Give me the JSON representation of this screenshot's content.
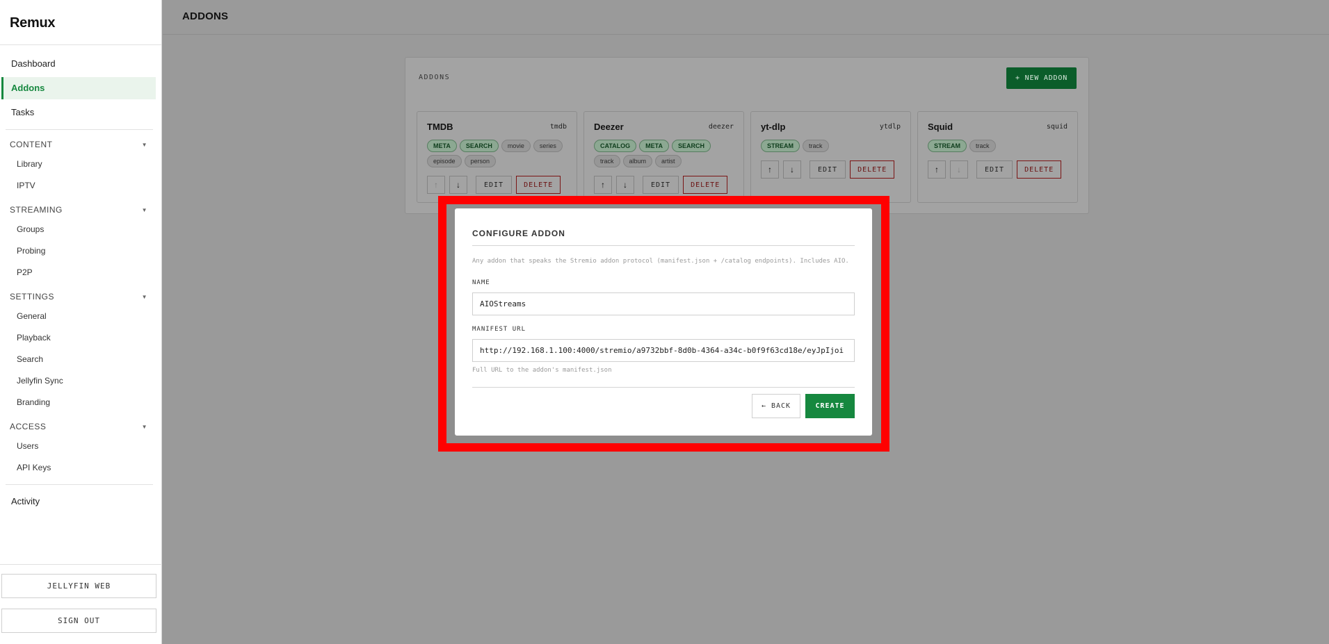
{
  "app": {
    "name": "Remux"
  },
  "sidebar": {
    "top_items": [
      {
        "label": "Dashboard"
      },
      {
        "label": "Addons"
      },
      {
        "label": "Tasks"
      }
    ],
    "sections": [
      {
        "title": "CONTENT",
        "items": [
          "Library",
          "IPTV"
        ]
      },
      {
        "title": "STREAMING",
        "items": [
          "Groups",
          "Probing",
          "P2P"
        ]
      },
      {
        "title": "SETTINGS",
        "items": [
          "General",
          "Playback",
          "Search",
          "Jellyfin Sync",
          "Branding"
        ]
      },
      {
        "title": "ACCESS",
        "items": [
          "Users",
          "API Keys"
        ]
      }
    ],
    "bottom_item": "Activity",
    "footer": {
      "jellyfin_web": "JELLYFIN WEB",
      "sign_out": "SIGN OUT"
    }
  },
  "header": {
    "title": "ADDONS"
  },
  "addons_panel": {
    "title": "ADDONS",
    "new_button": "+ NEW ADDON",
    "edit_label": "EDIT",
    "delete_label": "DELETE",
    "up_arrow": "↑",
    "down_arrow": "↓",
    "cards": [
      {
        "name": "TMDB",
        "id": "tmdb",
        "caps": [
          "META",
          "SEARCH"
        ],
        "types": [
          "movie",
          "series",
          "episode",
          "person"
        ],
        "up_enabled": false,
        "down_enabled": true
      },
      {
        "name": "Deezer",
        "id": "deezer",
        "caps": [
          "CATALOG",
          "META",
          "SEARCH"
        ],
        "types": [
          "track",
          "album",
          "artist"
        ],
        "up_enabled": true,
        "down_enabled": true
      },
      {
        "name": "yt-dlp",
        "id": "ytdlp",
        "caps": [
          "STREAM"
        ],
        "types": [
          "track"
        ],
        "up_enabled": true,
        "down_enabled": true
      },
      {
        "name": "Squid",
        "id": "squid",
        "caps": [
          "STREAM"
        ],
        "types": [
          "track"
        ],
        "up_enabled": true,
        "down_enabled": false
      }
    ]
  },
  "modal": {
    "title": "CONFIGURE ADDON",
    "description": "Any addon that speaks the Stremio addon protocol (manifest.json + /catalog endpoints). Includes AIO.",
    "name_label": "NAME",
    "name_value": "AIOStreams",
    "url_label": "MANIFEST URL",
    "url_value": "http://192.168.1.100:4000/stremio/a9732bbf-8d0b-4364-a34c-b0f9f63cd18e/eyJpIjoi",
    "url_help": "Full URL to the addon's manifest.json",
    "back_label": "← BACK",
    "create_label": "CREATE"
  },
  "colors": {
    "accent": "#16883f",
    "danger": "#c62828",
    "highlight_frame": "#ff0000"
  }
}
